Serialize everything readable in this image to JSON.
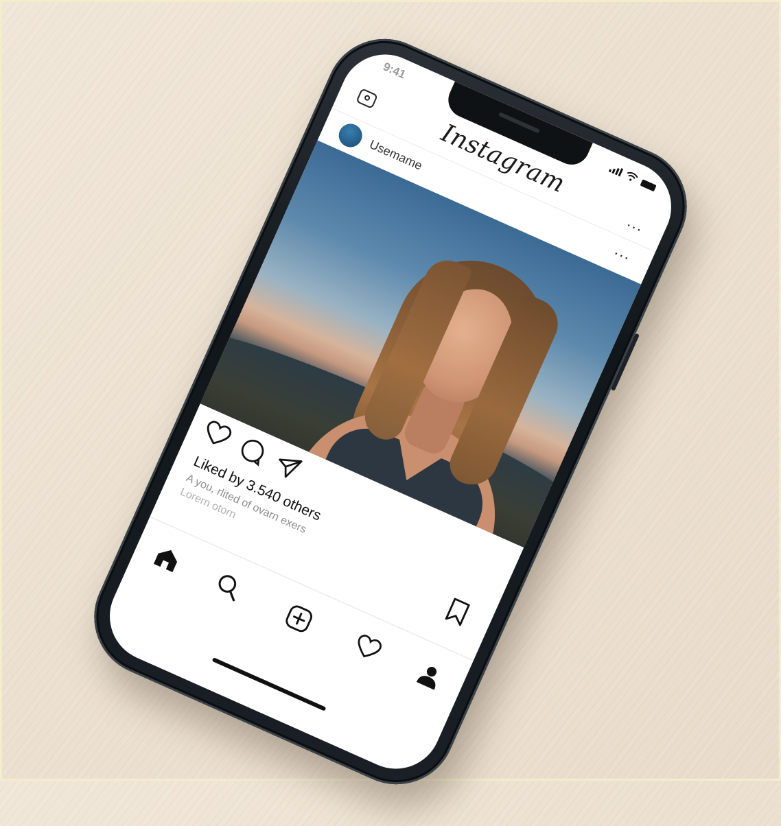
{
  "status_bar": {
    "time": "9:41"
  },
  "app": {
    "logo_text": "Instagram"
  },
  "post": {
    "username": "Usemame",
    "more": "...",
    "likes_text": "Liked by 3.540 others",
    "caption_line1": "A you, rlited of ovarn exers",
    "caption_line2": "Lorern otorn"
  },
  "header": {
    "more": "..."
  },
  "icons": {
    "camera": "camera-icon",
    "like": "heart-outline-icon",
    "comment": "comment-bubble-icon",
    "share": "paper-plane-icon",
    "save": "bookmark-icon",
    "home": "home-icon",
    "search": "search-icon",
    "new_post": "add-square-icon",
    "activity": "heart-outline-icon",
    "profile": "person-icon"
  },
  "colors": {
    "avatar": "#215a85",
    "phone_body": "#11161a",
    "table_surface": "#ece1d1"
  }
}
